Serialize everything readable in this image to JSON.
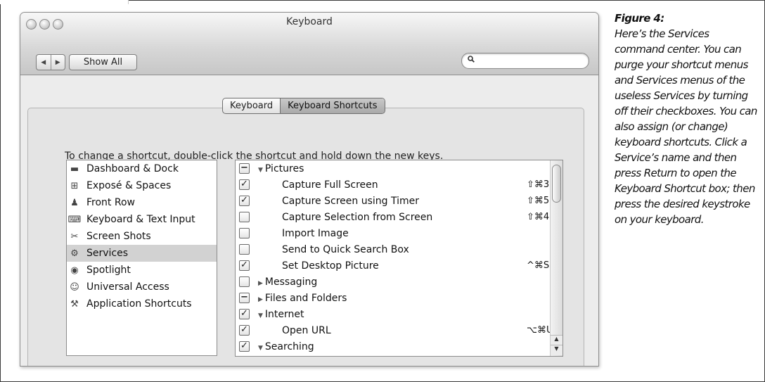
{
  "window": {
    "title": "Keyboard",
    "nav_back": "◀",
    "nav_forward": "▶",
    "show_all": "Show All",
    "search_placeholder": ""
  },
  "tabs": [
    {
      "label": "Keyboard",
      "selected": false
    },
    {
      "label": "Keyboard Shortcuts",
      "selected": true
    }
  ],
  "instruction": "To change a shortcut, double-click the shortcut and hold down the new keys.",
  "categories": [
    {
      "label": "Dashboard & Dock",
      "icon": "dashboard-icon",
      "selected": false
    },
    {
      "label": "Exposé & Spaces",
      "icon": "expose-icon",
      "selected": false
    },
    {
      "label": "Front Row",
      "icon": "front-row-icon",
      "selected": false
    },
    {
      "label": "Keyboard & Text Input",
      "icon": "keyboard-icon",
      "selected": false
    },
    {
      "label": "Screen Shots",
      "icon": "screenshot-icon",
      "selected": false
    },
    {
      "label": "Services",
      "icon": "gear-icon",
      "selected": true
    },
    {
      "label": "Spotlight",
      "icon": "spotlight-icon",
      "selected": false
    },
    {
      "label": "Universal Access",
      "icon": "accessibility-icon",
      "selected": false
    },
    {
      "label": "Application Shortcuts",
      "icon": "app-shortcut-icon",
      "selected": false
    }
  ],
  "shortcuts": [
    {
      "label": "Pictures",
      "group": true,
      "expanded": true,
      "check": "mixed",
      "shortcut": ""
    },
    {
      "label": "Capture Full Screen",
      "group": false,
      "check": "on",
      "shortcut": "⇧⌘3"
    },
    {
      "label": "Capture Screen using Timer",
      "group": false,
      "check": "on",
      "shortcut": "⇧⌘5"
    },
    {
      "label": "Capture Selection from Screen",
      "group": false,
      "check": "off",
      "shortcut": "⇧⌘4"
    },
    {
      "label": "Import Image",
      "group": false,
      "check": "off",
      "shortcut": ""
    },
    {
      "label": "Send to Quick Search Box",
      "group": false,
      "check": "off",
      "shortcut": ""
    },
    {
      "label": "Set Desktop Picture",
      "group": false,
      "check": "on",
      "shortcut": "^⌘S"
    },
    {
      "label": "Messaging",
      "group": true,
      "expanded": false,
      "check": "off",
      "shortcut": ""
    },
    {
      "label": "Files and Folders",
      "group": true,
      "expanded": false,
      "check": "mixed",
      "shortcut": ""
    },
    {
      "label": "Internet",
      "group": true,
      "expanded": true,
      "check": "on",
      "shortcut": ""
    },
    {
      "label": "Open URL",
      "group": false,
      "check": "on",
      "shortcut": "⌥⌘U"
    },
    {
      "label": "Searching",
      "group": true,
      "expanded": true,
      "check": "on",
      "shortcut": ""
    }
  ],
  "caption": {
    "title": "Figure 4:",
    "text": "Here’s the Services command center. You can purge your shortcut menus and Services menus of the useless Services by turning off their checkboxes. You can also assign (or change) keyboard shortcuts. Click a Service’s name and then press Return to open the Keyboard Shortcut box; then press the desired keystroke on your keyboard."
  }
}
